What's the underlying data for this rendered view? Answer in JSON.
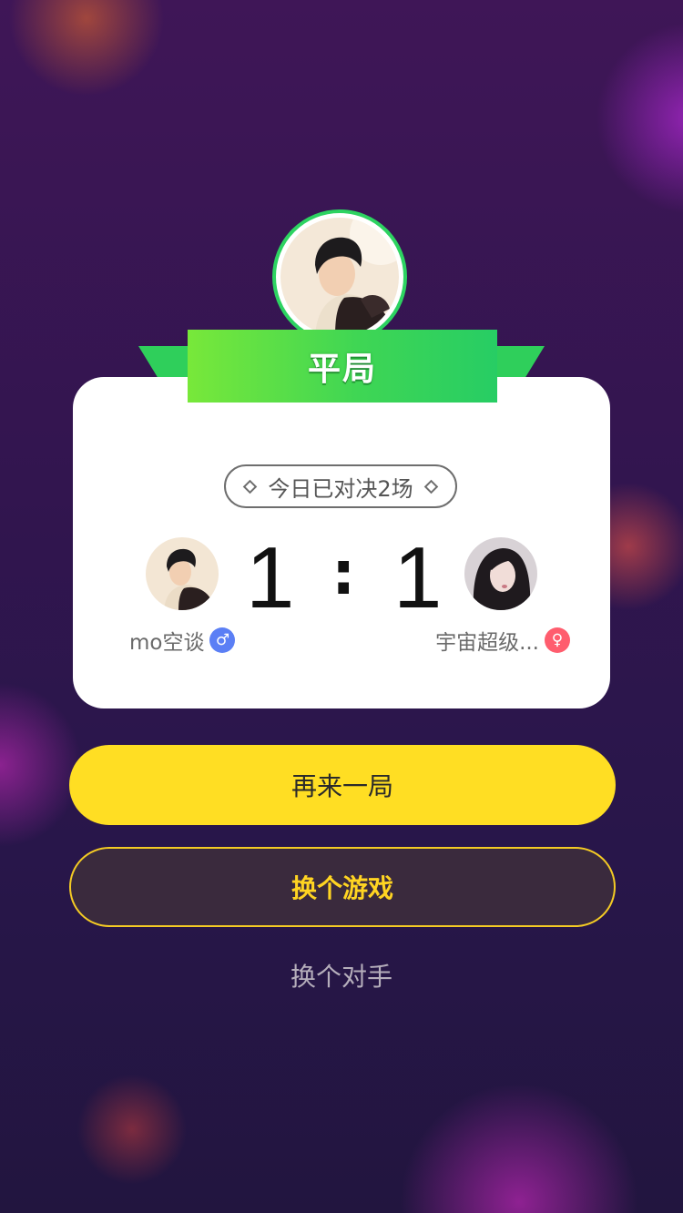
{
  "result": {
    "title": "平局",
    "daily_matches": "今日已对决2场"
  },
  "players": {
    "left": {
      "name": "mo空谈",
      "gender_icon": "♂",
      "gender_color": "#5b7ff5",
      "score": "1"
    },
    "right": {
      "name": "宇宙超级...",
      "gender_icon": "♀",
      "gender_color": "#ff5d6e",
      "score": "1"
    }
  },
  "score_separator": ":",
  "actions": {
    "play_again": "再来一局",
    "change_game": "换个游戏",
    "change_opponent": "换个对手"
  },
  "colors": {
    "ribbon_green": "#3fd654",
    "primary_yellow": "#ffde23",
    "secondary_text": "#ffd422"
  }
}
